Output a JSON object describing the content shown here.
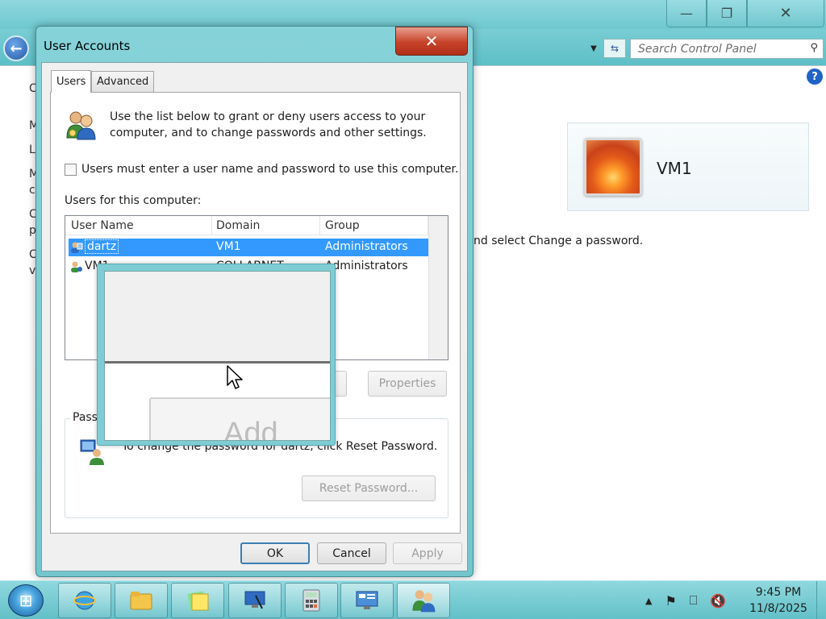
{
  "control_panel": {
    "search_placeholder": "Search Control Panel",
    "left_letters": [
      "C",
      "M",
      "L",
      "M",
      "c",
      "C",
      "p",
      "C",
      "v"
    ],
    "user_card_name": "VM1",
    "partial_text": "nd select Change a password."
  },
  "dialog": {
    "title": "User Accounts",
    "tabs": [
      "Users",
      "Advanced"
    ],
    "intro": "Use the list below to grant or deny users access to your computer, and to change passwords and other settings.",
    "checkbox_label": "Users must enter a user name and password to use this computer.",
    "checkbox_checked": false,
    "list_label": "Users for this computer:",
    "columns": [
      "User Name",
      "Domain",
      "Group"
    ],
    "rows": [
      {
        "user": "dartz",
        "domain": "VM1",
        "group": "Administrators",
        "selected": true
      },
      {
        "user": "VM1",
        "domain": "COLLABNET",
        "group": "Administrators",
        "selected": false
      }
    ],
    "row2_visible": {
      "user": "VM1",
      "domain": "COLLABNET",
      "group": "Administrators"
    },
    "properties_button": "Properties",
    "remove_button_partial": "e",
    "password_group_label": "Passw",
    "password_text": "To change the password for dartz, click Reset Password.",
    "reset_password_button": "Reset Password...",
    "ok_button": "OK",
    "cancel_button": "Cancel",
    "apply_button": "Apply",
    "ghost_button_label": "Add"
  },
  "taskbar": {
    "time": "9:45 PM",
    "date": "11/8/2025"
  },
  "colors": {
    "titlebar": "#79cdd4",
    "selection": "#3399ff",
    "close_button": "#c8422a"
  }
}
